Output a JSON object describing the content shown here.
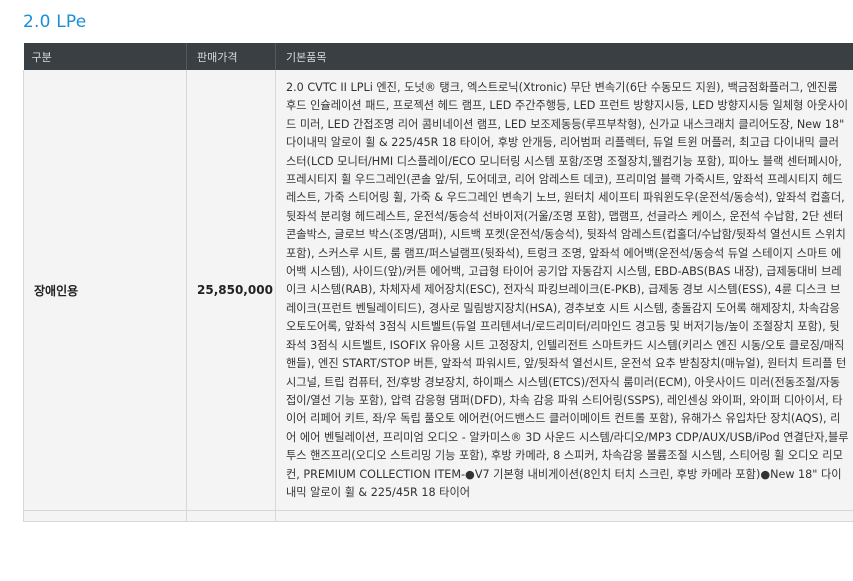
{
  "section": {
    "title": "2.0 LPe"
  },
  "table": {
    "headers": {
      "trim": "구분",
      "price": "판매가격",
      "options": "기본품목"
    },
    "rows": [
      {
        "trim": "장애인용",
        "price": "25,850,000",
        "options": "2.0 CVTC II LPLi 엔진, 도넛® 탱크, 엑스트로닉(Xtronic) 무단 변속기(6단 수동모드 지원), 백금점화플러그, 엔진룸 후드 인슐레이션 패드, 프로젝션 헤드 램프, LED 주간주행등, LED 프런트 방향지시등, LED 방향지시등 일체형 아웃사이드 미러, LED 간접조명 리어 콤비네이션 램프, LED 보조제동등(루프부착형), 신가교 내스크래치 클리어도장, New 18\" 다이내믹 알로이 휠 & 225/45R 18 타이어, 후방 안개등, 리어범퍼 리플렉터, 듀얼 트윈 머플러, 최고급 다이내믹 클러스터(LCD 모니터/HMI 디스플레이/ECO 모니터링 시스템 포함/조명 조절장치,웰컴기능 포함), 피아노 블랙 센터페시아, 프레시티지 휠 우드그레인(콘솔 앞/뒤, 도어데코, 리어 암레스트 데코), 프리미엄 블랙 가죽시트, 앞좌석 프레시티지 헤드레스트, 가죽 스티어링 휠, 가죽 & 우드그레인 변속기 노브, 원터치 세이프티 파워윈도우(운전석/동승석), 앞좌석 컵홀더, 뒷좌석 분리형 헤드레스트, 운전석/동승석 선바이저(거울/조명 포함), 맵램프, 선글라스 케이스, 운전석 수납함, 2단 센터콘솔박스, 글로브 박스(조명/댐퍼), 시트백 포켓(운전석/동승석), 뒷좌석 암레스트(컵홀더/수납함/뒷좌석 열선시트 스위치 포함), 스커스루 시트, 룸 램프/퍼스널램프(뒷좌석), 트렁크 조명, 앞좌석 에어백(운전석/동승석 듀얼 스테이지 스마트 에어백 시스템), 사이드(앞)/커튼 에어백, 고급형 타이어 공기압 자동감지 시스템, EBD-ABS(BAS 내장), 급제동대비 브레이크 시스템(RAB), 차체자세 제어장치(ESC), 전자식 파킹브레이크(E-PKB), 급제동 경보 시스템(ESS), 4륜 디스크 브레이크(프런트 벤틸레이티드), 경사로 밀림방지장치(HSA), 경추보호 시트 시스템, 충돌감지 도어록 해제장치, 차속감응 오토도어록, 앞좌석 3점식 시트벨트(듀얼 프리텐셔너/로드리미터/리마인드 경고등 및 버저기능/높이 조절장치 포함), 뒷좌석 3점식 시트벨트, ISOFIX 유아용 시트 고정장치, 인텔리전트 스마트카드 시스템(키리스 엔진 시동/오토 클로징/매직핸들), 엔진 START/STOP 버튼, 앞좌석 파워시트, 앞/뒷좌석 열선시트, 운전석 요추 받침장치(매뉴얼), 원터치 트리플 턴 시그널, 트립 컴퓨터, 전/후방 경보장치, 하이패스 시스템(ETCS)/전자식 룸미러(ECM), 아웃사이드 미러(전동조절/자동접이/열선 기능 포함), 압력 감응형 댐퍼(DFD), 차속 감응 파워 스티어링(SSPS), 레인센싱 와이퍼, 와이퍼 디아이서, 타이어 리페어 키트, 좌/우 독립 풀오토 에어컨(어드밴스드 클러이메이트 컨트롤 포함), 유해가스 유입차단 장치(AQS), 리어 에어 벤틸레이션, 프리미엄 오디오 - 알카미스® 3D 사운드 시스템/라디오/MP3 CDP/AUX/USB/iPod 연결단자,블루투스 핸즈프리(오디오 스트리밍 기능 포함), 후방 카메라, 8 스피커, 차속감응 볼륨조절 시스템, 스티어링 휠 오디오 리모컨, PREMIUM COLLECTION ITEM-●V7 기본형 내비게이션(8인치 터치 스크린, 후방 카메라 포함)●New 18\" 다이내믹 알로이 휠 & 225/45R 18 타이어"
      }
    ]
  }
}
